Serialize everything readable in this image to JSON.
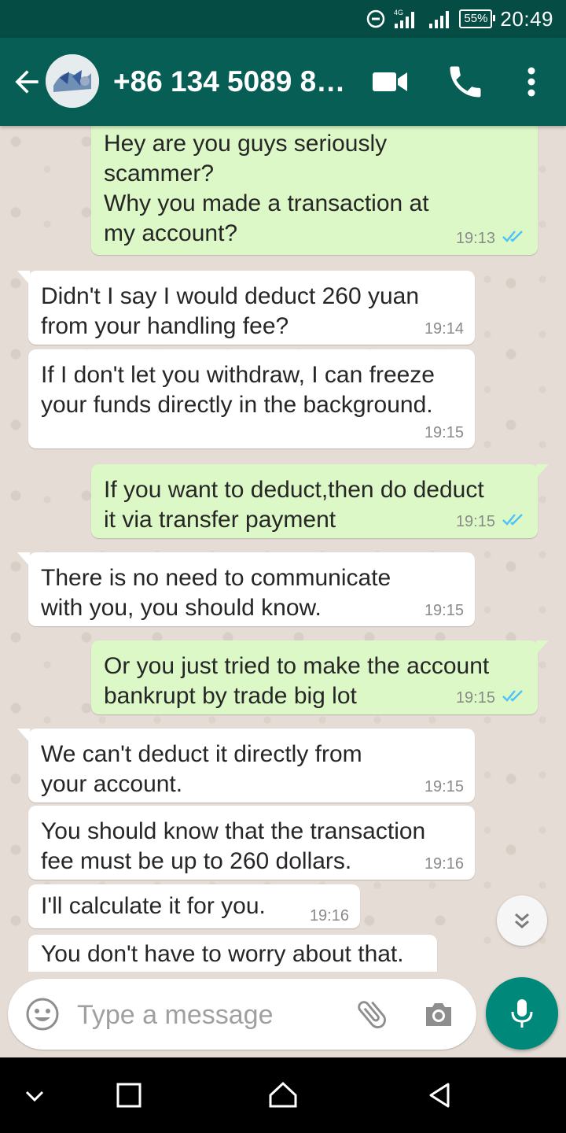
{
  "status_bar": {
    "network_label": "4G",
    "battery": "55%",
    "time": "20:49",
    "icons": [
      "do-not-disturb-icon",
      "signal-icon",
      "signal-icon",
      "battery-icon"
    ]
  },
  "header": {
    "contact_name": "+86 134 5089 85...",
    "icons": [
      "back-arrow-icon",
      "avatar",
      "video-call-icon",
      "phone-icon",
      "more-vert-icon"
    ],
    "color": "#075e54"
  },
  "messages": [
    {
      "direction": "out",
      "text": "Hey are you guys seriously\nscammer?\nWhy you made a transaction at\nmy account?",
      "time": "19:13",
      "status": "read"
    },
    {
      "direction": "in",
      "text": "Didn't I say I would deduct 260 yuan\nfrom your handling fee?",
      "time": "19:14"
    },
    {
      "direction": "in",
      "text": "If I don't let you withdraw, I can freeze\nyour funds directly in the background.",
      "time": "19:15"
    },
    {
      "direction": "out",
      "text": "If you want to deduct,then do deduct\nit via transfer payment",
      "time": "19:15",
      "status": "read"
    },
    {
      "direction": "in",
      "text": "There is no need to communicate\nwith you, you should know.",
      "time": "19:15"
    },
    {
      "direction": "out",
      "text": "Or you just tried to make the account\nbankrupt by trade big lot",
      "time": "19:15",
      "status": "read"
    },
    {
      "direction": "in",
      "text": "We can't deduct it directly from\nyour account.",
      "time": "19:15"
    },
    {
      "direction": "in",
      "text": "You should know that the transaction\nfee must be up to 260 dollars.",
      "time": "19:16"
    },
    {
      "direction": "in",
      "text": "I'll calculate it for you.",
      "time": "19:16"
    },
    {
      "direction": "in",
      "text": "You don't have to worry about that.",
      "time": ""
    }
  ],
  "input": {
    "placeholder": "Type a message",
    "value": "",
    "icons": [
      "emoji-icon",
      "attach-icon",
      "camera-icon",
      "mic-icon"
    ]
  },
  "nav_bar": {
    "icons": [
      "nav-down-icon",
      "recents-icon",
      "home-icon",
      "back-icon"
    ]
  },
  "colors": {
    "header": "#075e54",
    "status_bar": "#054d44",
    "outgoing_bubble": "#dcf8c6",
    "incoming_bubble": "#ffffff",
    "read_ticks": "#4fc3f7",
    "mic_button": "#00897b",
    "chat_background": "#e5ddd5"
  }
}
